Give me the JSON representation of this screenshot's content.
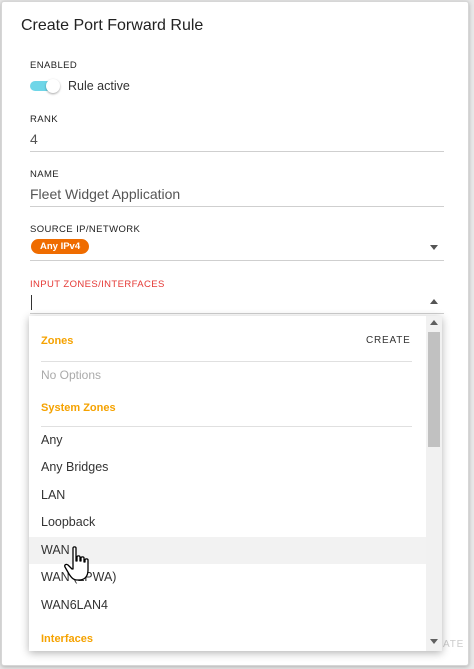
{
  "dialog": {
    "title": "Create Port Forward Rule"
  },
  "fields": {
    "enabled": {
      "label": "ENABLED",
      "toggle_label": "Rule active",
      "toggle_on": true
    },
    "rank": {
      "label": "RANK",
      "value": "4"
    },
    "name": {
      "label": "NAME",
      "value": "Fleet Widget Application"
    },
    "source": {
      "label": "SOURCE IP/NETWORK",
      "chip": "Any IPv4"
    },
    "input_zones": {
      "label": "INPUT ZONES/INTERFACES",
      "value": ""
    }
  },
  "dropdown": {
    "zones_header": "Zones",
    "create_label": "CREATE",
    "no_options": "No Options",
    "system_zones_header": "System Zones",
    "items": [
      "Any",
      "Any Bridges",
      "LAN",
      "Loopback",
      "WAN",
      "WAN (LPWA)",
      "WAN6LAN4"
    ],
    "interfaces_header": "Interfaces",
    "hovered_item": "WAN"
  },
  "footer": {
    "partial_button": "ATE"
  },
  "colors": {
    "toggle_track": "#6fd6e8",
    "chip_bg": "#ef6c00",
    "section_header": "#f5a200",
    "error_label": "#e53935"
  }
}
